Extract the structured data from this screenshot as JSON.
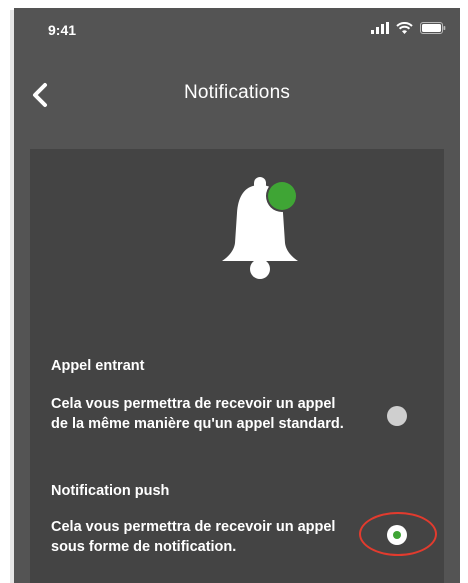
{
  "colors": {
    "screen_bg": "#545454",
    "card_bg": "#444444",
    "accent_green": "#3fa535",
    "highlight_red": "#e23b2e",
    "text": "#ffffff"
  },
  "status_bar": {
    "time": "9:41",
    "icons": [
      "signal-icon",
      "wifi-icon",
      "battery-icon"
    ]
  },
  "nav": {
    "back_icon": "chevron-left-icon",
    "title": "Notifications"
  },
  "card": {
    "icon": "bell-notification-icon",
    "options": [
      {
        "title": "Appel entrant",
        "description": "Cela vous permettra de recevoir un appel de la même manière qu'un appel standard.",
        "selected": false
      },
      {
        "title": "Notification push",
        "description": "Cela vous permettra de recevoir un appel sous forme de notification.",
        "selected": true
      }
    ]
  }
}
